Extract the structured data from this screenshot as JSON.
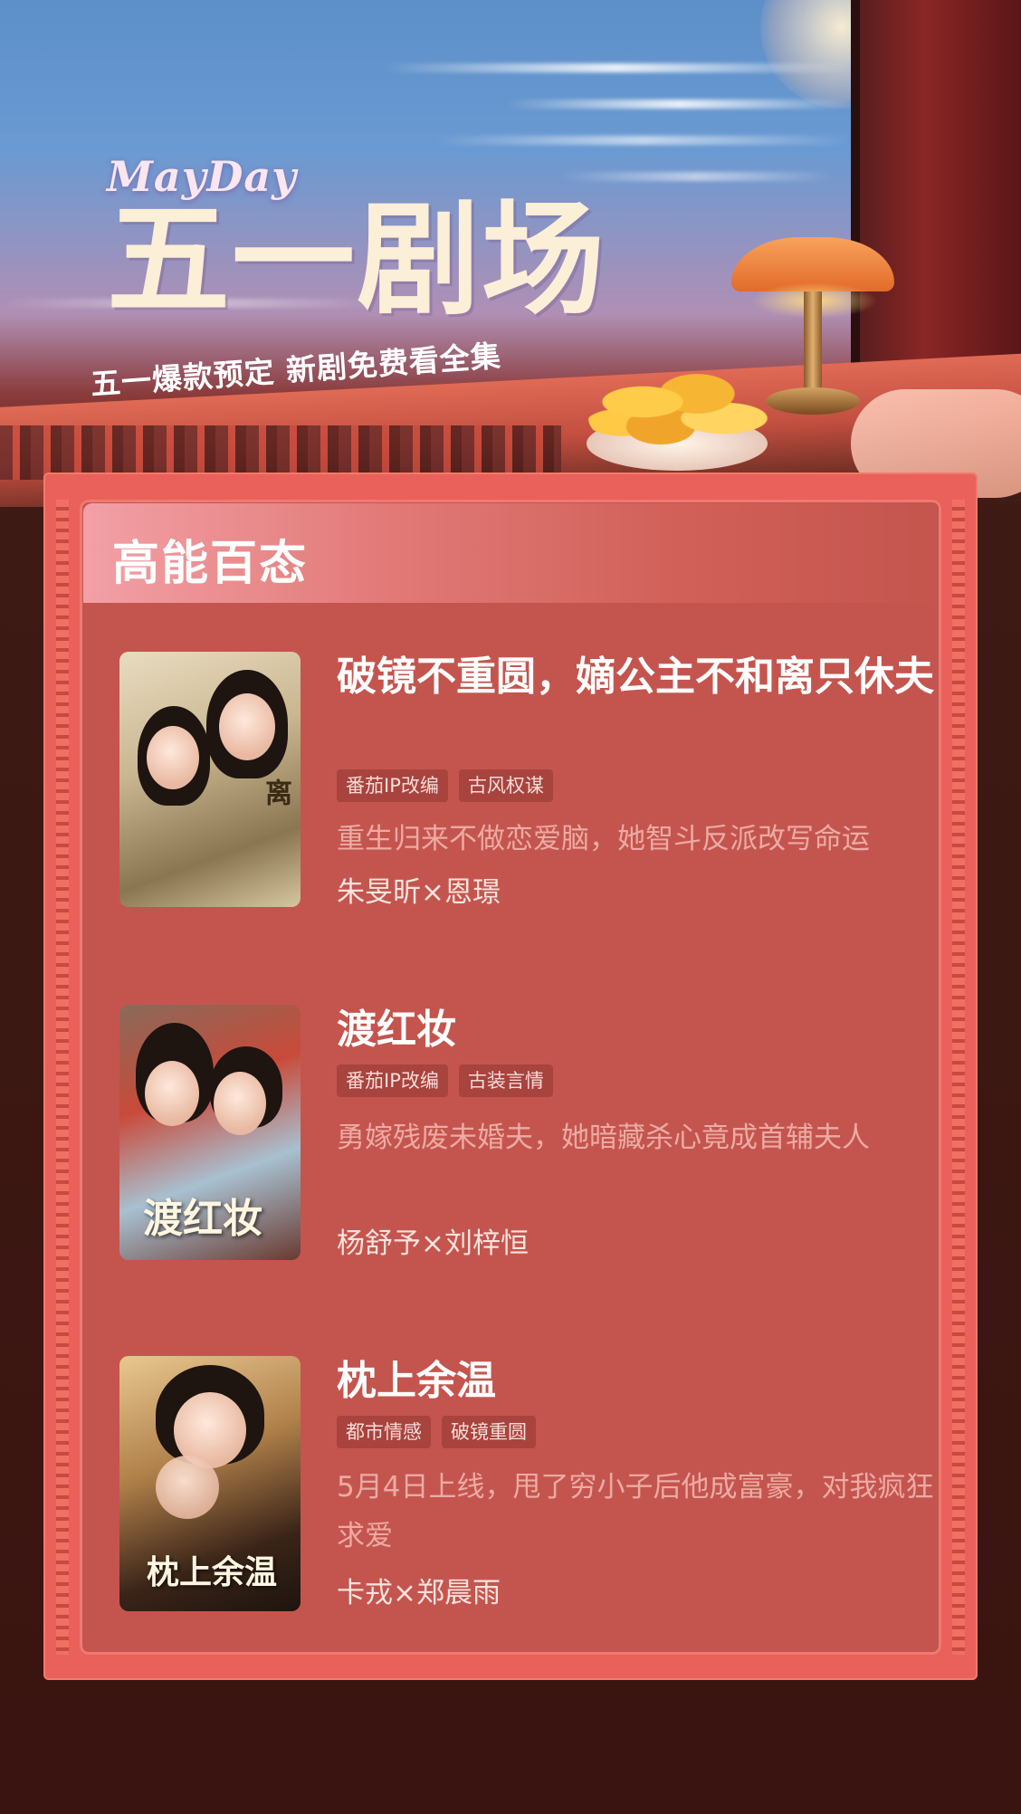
{
  "hero": {
    "mayday": "MayDay",
    "title": "五一剧场",
    "subtitle": "五一爆款预定 新剧免费看全集"
  },
  "section": {
    "title": "高能百态"
  },
  "shows": [
    {
      "title": "破镜不重圆，嫡公主不和离只休夫",
      "tags": [
        "番茄IP改编",
        "古风权谋"
      ],
      "description": "重生归来不做恋爱脑，她智斗反派改写命运",
      "cast": "朱旻昕×恩璟",
      "poster_text": "嫡姐不和离"
    },
    {
      "title": "渡红妆",
      "tags": [
        "番茄IP改编",
        "古装言情"
      ],
      "description": "勇嫁残废未婚夫，她暗藏杀心竟成首辅夫人",
      "cast": "杨舒予×刘梓恒",
      "poster_text": "渡红妆"
    },
    {
      "title": "枕上余温",
      "tags": [
        "都市情感",
        "破镜重圆"
      ],
      "description": "5月4日上线，甩了穷小子后他成富豪，对我疯狂求爱",
      "cast": "卡戎×郑晨雨",
      "poster_text": "枕上余温"
    }
  ],
  "colors": {
    "panel": "#c4554e",
    "panel_border": "#e9615a",
    "tag_bg": "#a8433e",
    "description": "#ecaba4",
    "background": "#3a1410"
  }
}
